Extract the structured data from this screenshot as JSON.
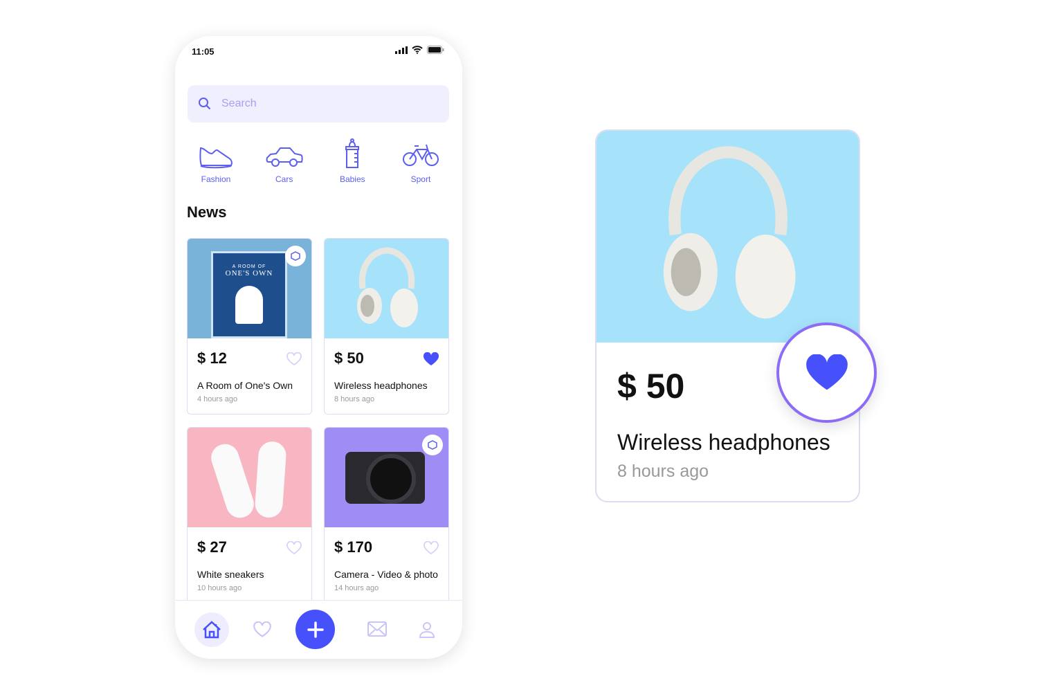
{
  "status_bar": {
    "time": "11:05",
    "icons": [
      "signal-icon",
      "wifi-icon",
      "battery-icon"
    ]
  },
  "search": {
    "placeholder": "Search"
  },
  "categories": [
    {
      "label": "Fashion",
      "icon": "sneaker-icon"
    },
    {
      "label": "Cars",
      "icon": "car-icon"
    },
    {
      "label": "Babies",
      "icon": "baby-bottle-icon"
    },
    {
      "label": "Sport",
      "icon": "bicycle-icon"
    }
  ],
  "section_title": "News",
  "products": [
    {
      "price": "$ 12",
      "title": "A Room of One's Own",
      "time": "4 hours ago",
      "liked": false,
      "image_text": [
        "A ROOM OF",
        "ONE'S OWN"
      ]
    },
    {
      "price": "$ 50",
      "title": "Wireless headphones",
      "time": "8 hours ago",
      "liked": true
    },
    {
      "price": "$ 27",
      "title": "White sneakers",
      "time": "10 hours ago",
      "liked": false
    },
    {
      "price": "$ 170",
      "title": "Camera - Video & photo",
      "time": "14 hours ago",
      "liked": false
    }
  ],
  "nav": [
    "home-icon",
    "heart-icon",
    "plus-icon",
    "mail-icon",
    "user-icon"
  ],
  "detail": {
    "price": "$ 50",
    "title": "Wireless headphones",
    "time": "8 hours ago",
    "liked": true
  },
  "colors": {
    "accent": "#4650fb",
    "light": "#ededfd",
    "border": "#8c6cf6"
  }
}
